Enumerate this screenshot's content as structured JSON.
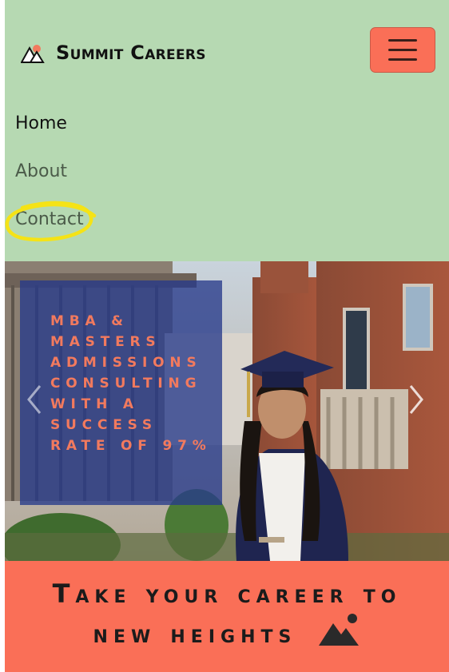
{
  "brand": {
    "name": "Summit Careers",
    "icon": "mountain-logo-icon"
  },
  "nav": {
    "toggler_icon": "hamburger-menu-icon",
    "items": [
      {
        "label": "Home",
        "active": true
      },
      {
        "label": "About",
        "active": false
      },
      {
        "label": "Contact",
        "active": false,
        "highlighted": true
      }
    ]
  },
  "hero": {
    "caption": "MBA & Masters Admissions Consulting with a success rate of 97%",
    "prev_icon": "chevron-left-icon",
    "next_icon": "chevron-right-icon"
  },
  "banner": {
    "line1": "Take your career to",
    "line2": "new heights",
    "icon": "mountain-icon"
  },
  "colors": {
    "navbar_bg": "#b6d9b2",
    "accent": "#fa6f57",
    "caption_box": "#263a8a",
    "caption_text": "#f27a5e",
    "highlight": "#f5e316"
  }
}
